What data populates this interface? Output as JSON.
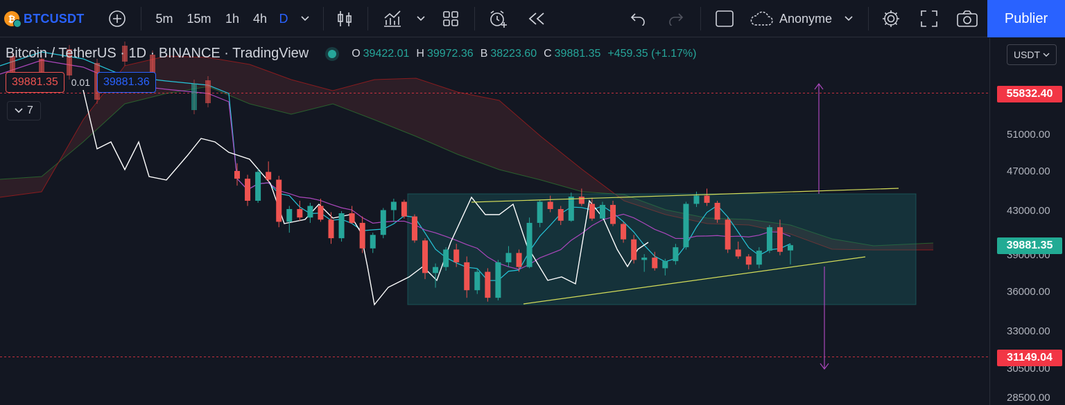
{
  "toolbar": {
    "symbol": "BTCUSDT",
    "timeframes": [
      "5m",
      "15m",
      "1h",
      "4h",
      "D"
    ],
    "active_timeframe": "D",
    "layout_name": "Anonyme",
    "publish_label": "Publier",
    "icons": [
      "btc-logo",
      "add-symbol-icon",
      "chevron-down-icon",
      "candles-icon",
      "indicators-icon",
      "templates-icon",
      "alert-icon",
      "replay-icon",
      "undo-icon",
      "redo-icon",
      "layout-icon",
      "cloud-icon",
      "settings-icon",
      "fullscreen-icon",
      "camera-icon"
    ]
  },
  "legend": {
    "title": "Bitcoin / TetherUS · 1D · BINANCE · TradingView",
    "open_label": "O",
    "open": "39422.01",
    "high_label": "H",
    "high": "39972.36",
    "low_label": "B",
    "low": "38223.60",
    "close_label": "C",
    "close": "39881.35",
    "change": "+459.35 (+1.17%)"
  },
  "trade": {
    "sell": "39881.35",
    "spread": "0.01",
    "buy": "39881.36"
  },
  "indicators_count": "7",
  "axis": {
    "currency": "USDT",
    "ticks": [
      "51000.00",
      "47000.00",
      "43000.00",
      "39000.00",
      "36000.00",
      "33000.00",
      "30500.00",
      "28500.00"
    ],
    "target_high": "55832.40",
    "current_price": "39881.35",
    "target_low": "31149.04"
  },
  "colors": {
    "bull": "#26a69a",
    "bear": "#ef5350",
    "accent": "#2962ff",
    "conversion": "#26c6da",
    "base": "#ab47bc",
    "lagging": "#ffffff",
    "trendline": "#d4dd5a",
    "range_box": "#1c6e6e"
  },
  "chart_data": {
    "type": "candlestick",
    "symbol": "BTCUSDT",
    "interval": "1D",
    "ylim": [
      28000,
      60000
    ],
    "y_scale": "log",
    "overlays": [
      "ichimoku-cloud",
      "tenkan-sen",
      "kijun-sen",
      "chikou-span",
      "ascending-triangle",
      "range-box",
      "measured-move-arrow"
    ],
    "candles_approx": [
      [
        47000,
        47800,
        45500,
        46200
      ],
      [
        46200,
        46600,
        43500,
        44000
      ],
      [
        44000,
        47200,
        43800,
        46900
      ],
      [
        46900,
        48000,
        45900,
        46100
      ],
      [
        46100,
        46500,
        41500,
        42000
      ],
      [
        42000,
        43500,
        41000,
        43200
      ],
      [
        43200,
        44000,
        42100,
        42400
      ],
      [
        42400,
        43800,
        41900,
        43500
      ],
      [
        43500,
        44200,
        42000,
        42200
      ],
      [
        42200,
        42900,
        40000,
        40500
      ],
      [
        40500,
        43000,
        40200,
        42800
      ],
      [
        42800,
        43500,
        41800,
        41900
      ],
      [
        41900,
        42500,
        39200,
        39600
      ],
      [
        39600,
        41000,
        39200,
        40800
      ],
      [
        40800,
        43300,
        40500,
        43100
      ],
      [
        43100,
        44200,
        42000,
        43900
      ],
      [
        43900,
        44100,
        42300,
        42500
      ],
      [
        42500,
        42700,
        40100,
        40300
      ],
      [
        40300,
        40500,
        37000,
        37500
      ],
      [
        37500,
        38300,
        36300,
        38000
      ],
      [
        38000,
        39700,
        37700,
        39500
      ],
      [
        39500,
        40000,
        38000,
        38400
      ],
      [
        38400,
        38900,
        35500,
        36100
      ],
      [
        36100,
        37900,
        35800,
        37600
      ],
      [
        37600,
        37900,
        35200,
        35500
      ],
      [
        35500,
        38600,
        35300,
        38400
      ],
      [
        38400,
        39800,
        38000,
        39200
      ],
      [
        39200,
        39500,
        37600,
        38000
      ],
      [
        38000,
        42400,
        37900,
        41900
      ],
      [
        41900,
        44100,
        41500,
        43900
      ],
      [
        43900,
        44500,
        42900,
        43200
      ],
      [
        43200,
        43500,
        41700,
        42100
      ],
      [
        42100,
        44800,
        42000,
        44400
      ],
      [
        44400,
        45200,
        43500,
        43700
      ],
      [
        43700,
        44300,
        42100,
        42300
      ],
      [
        42300,
        43900,
        42200,
        43600
      ],
      [
        43600,
        44000,
        41600,
        41800
      ],
      [
        41800,
        42000,
        40100,
        40400
      ],
      [
        40400,
        40800,
        38300,
        38600
      ],
      [
        38600,
        39100,
        37600,
        38800
      ],
      [
        38800,
        39300,
        37700,
        37900
      ],
      [
        37900,
        38700,
        37300,
        38500
      ],
      [
        38500,
        40000,
        38200,
        39700
      ],
      [
        39700,
        43900,
        39500,
        43700
      ],
      [
        43700,
        44900,
        43400,
        44500
      ],
      [
        44500,
        45200,
        43500,
        43800
      ],
      [
        43800,
        44000,
        41900,
        42200
      ],
      [
        42200,
        42400,
        39200,
        39500
      ],
      [
        39500,
        40200,
        38700,
        38900
      ],
      [
        38900,
        39100,
        37800,
        38200
      ],
      [
        38200,
        39700,
        37900,
        39400
      ],
      [
        39400,
        41700,
        39200,
        41500
      ],
      [
        41500,
        42200,
        39000,
        39300
      ],
      [
        39422.01,
        39972.36,
        38223.6,
        39881.35
      ]
    ]
  }
}
